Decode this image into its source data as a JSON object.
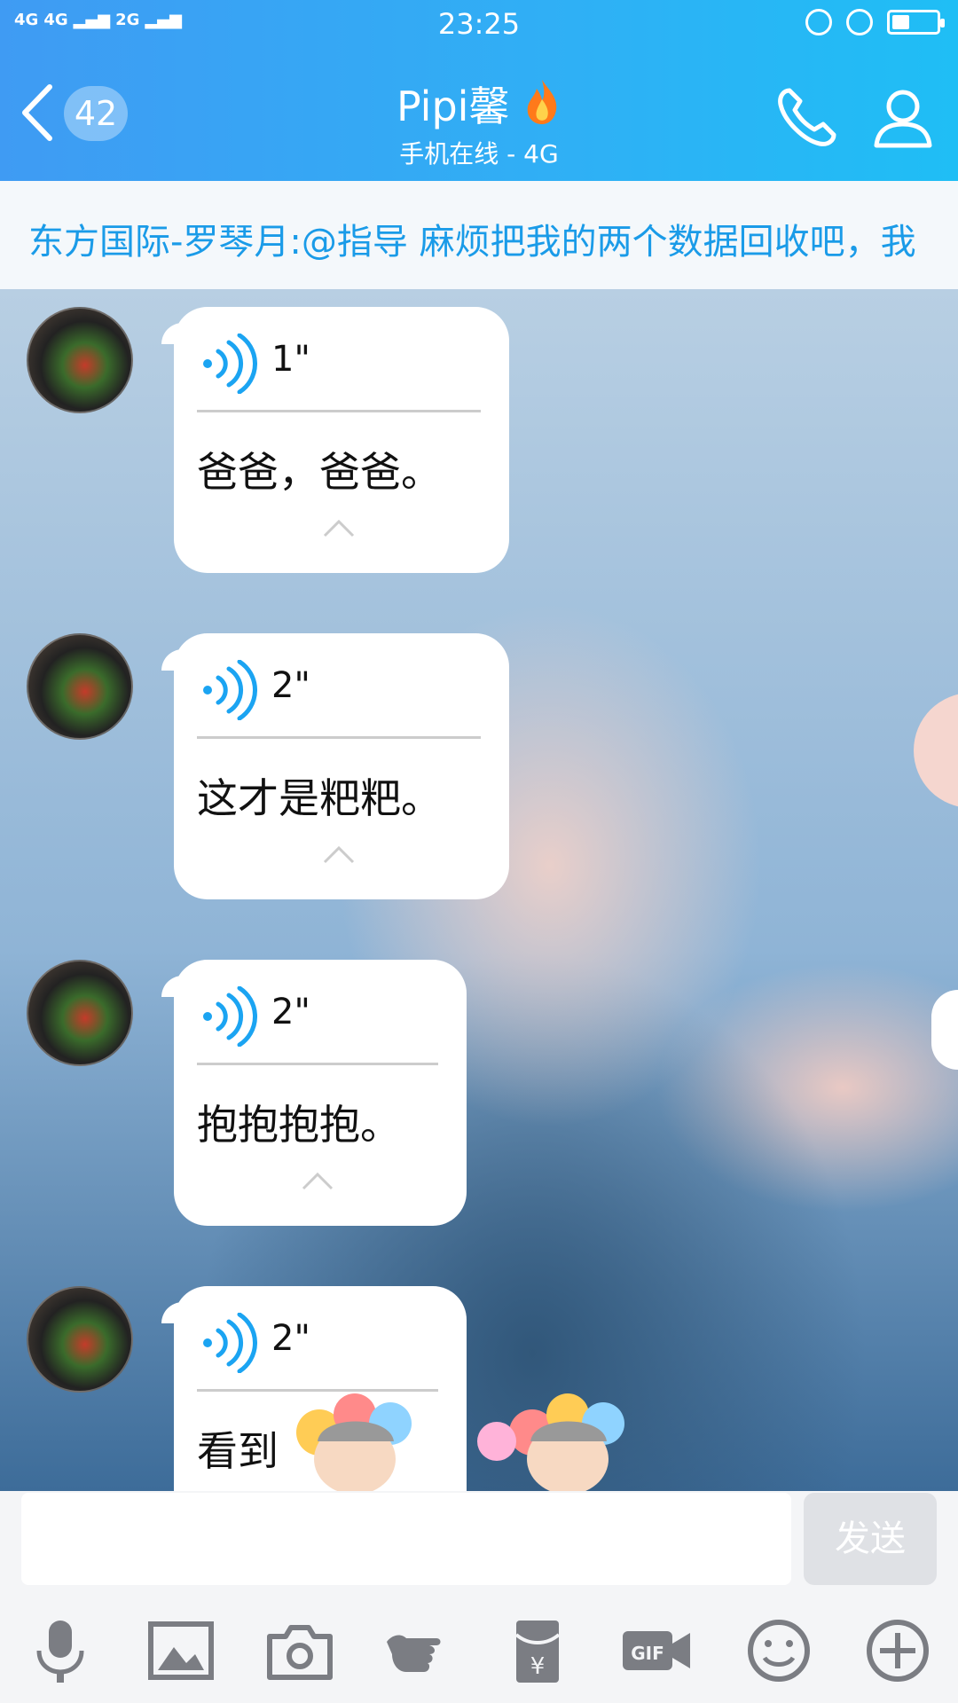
{
  "status_bar": {
    "network_1": "4G",
    "network_2": "4G",
    "network_3": "2G",
    "time": "23:25",
    "battery_level": 0.4
  },
  "header": {
    "back_icon": "chevron-left-icon",
    "unread_count": "42",
    "contact_name": "Pipi馨",
    "flame_icon": "flame-icon",
    "status": "手机在线 - 4G",
    "call_icon": "phone-icon",
    "profile_icon": "person-icon"
  },
  "notice": {
    "text": "东方国际-罗琴月:@指导 麻烦把我的两个数据回收吧，我"
  },
  "messages": [
    {
      "duration": "1\"",
      "transcript": "爸爸，爸爸。"
    },
    {
      "duration": "2\"",
      "transcript": "这才是粑粑。"
    },
    {
      "duration": "2\"",
      "transcript": "抱抱抱抱。"
    },
    {
      "duration": "2\"",
      "transcript": "看到"
    }
  ],
  "input": {
    "value": "",
    "send_label": "发送"
  },
  "toolbar": [
    "microphone-icon",
    "image-icon",
    "camera-icon",
    "poke-icon",
    "red-packet-icon",
    "gif-icon",
    "emoji-icon",
    "plus-icon"
  ],
  "colors": {
    "header_start": "#3f9bf3",
    "header_end": "#1fbef5",
    "accent": "#1a9be8",
    "voice_icon": "#1ba4f2"
  }
}
